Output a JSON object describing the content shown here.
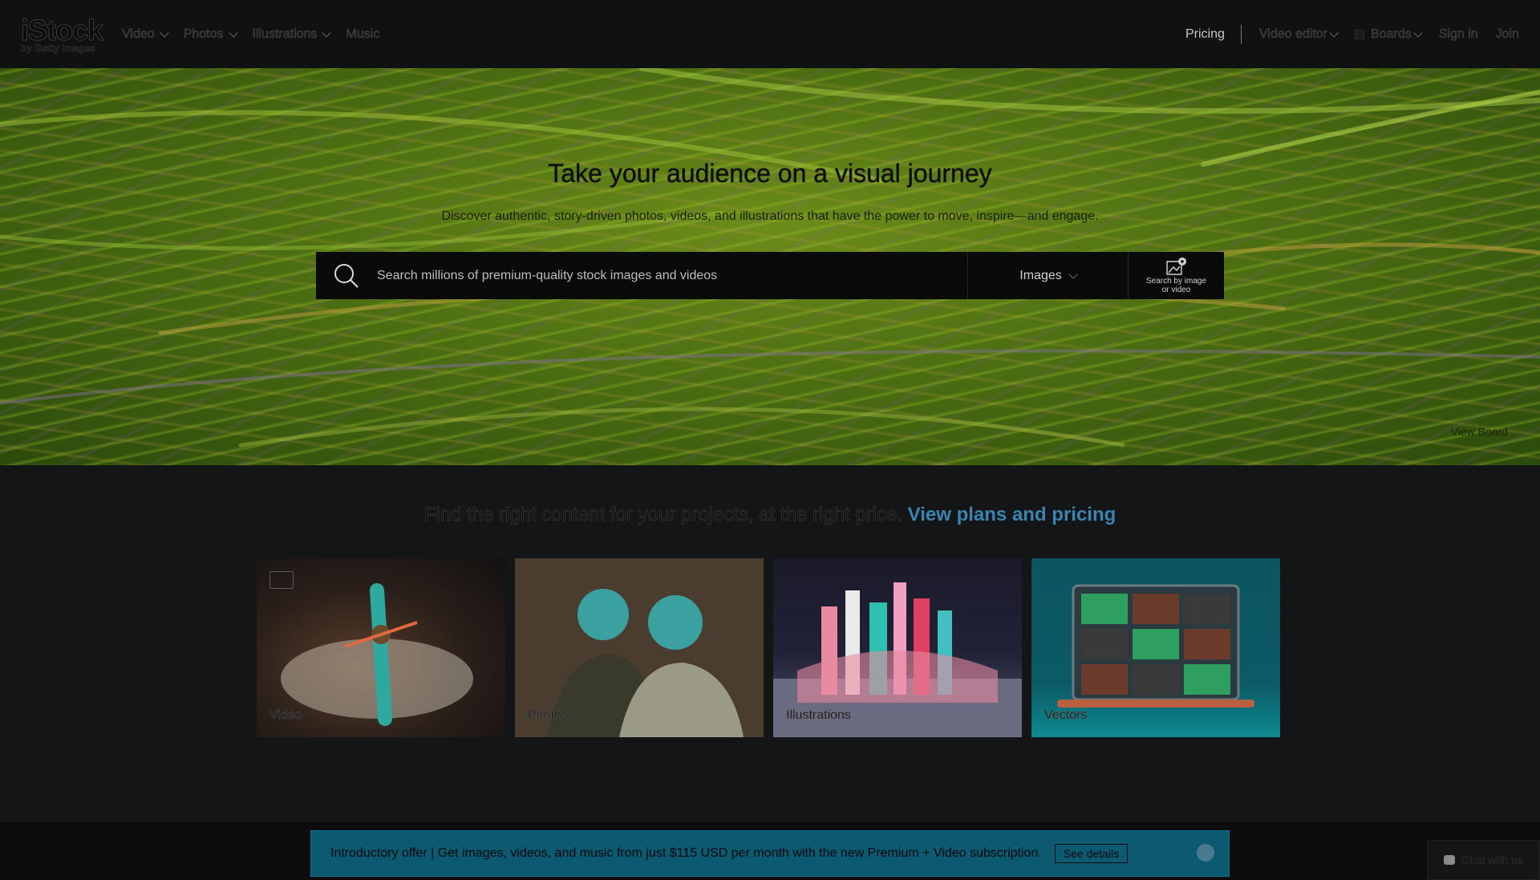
{
  "brand": {
    "name": "iStock",
    "sub": "by Getty Images"
  },
  "nav": {
    "left": [
      {
        "label": "Video",
        "has_menu": true
      },
      {
        "label": "Photos",
        "has_menu": true
      },
      {
        "label": "Illustrations",
        "has_menu": true
      },
      {
        "label": "Music",
        "has_menu": false
      }
    ],
    "pricing": "Pricing",
    "video_editor": "Video editor",
    "boards": "Boards",
    "sign_in": "Sign in",
    "join": "Join"
  },
  "hero": {
    "title": "Take your audience on a visual journey",
    "subtitle": "Discover authentic, story-driven photos, videos, and illustrations that have the power to move, inspire—and engage.",
    "search_placeholder": "Search millions of premium-quality stock images and videos",
    "search_type": "Images",
    "search_by_image_line1": "Search by image",
    "search_by_image_line2": "or video",
    "view_board": "View Board"
  },
  "promo": {
    "text": "Find the right content for your projects, at the right price.",
    "link": "View plans and pricing"
  },
  "categories": [
    {
      "label": "Video"
    },
    {
      "label": "Photos"
    },
    {
      "label": "Illustrations"
    },
    {
      "label": "Vectors"
    }
  ],
  "offer": {
    "text": "Introductory offer | Get images, videos, and music from just $115 USD per month with the new Premium + Video subscription.",
    "button": "See details"
  },
  "chat": {
    "label": "Chat with us"
  },
  "colors": {
    "accent_link": "#3a84b0",
    "offer_bg": "#0b5a72"
  }
}
